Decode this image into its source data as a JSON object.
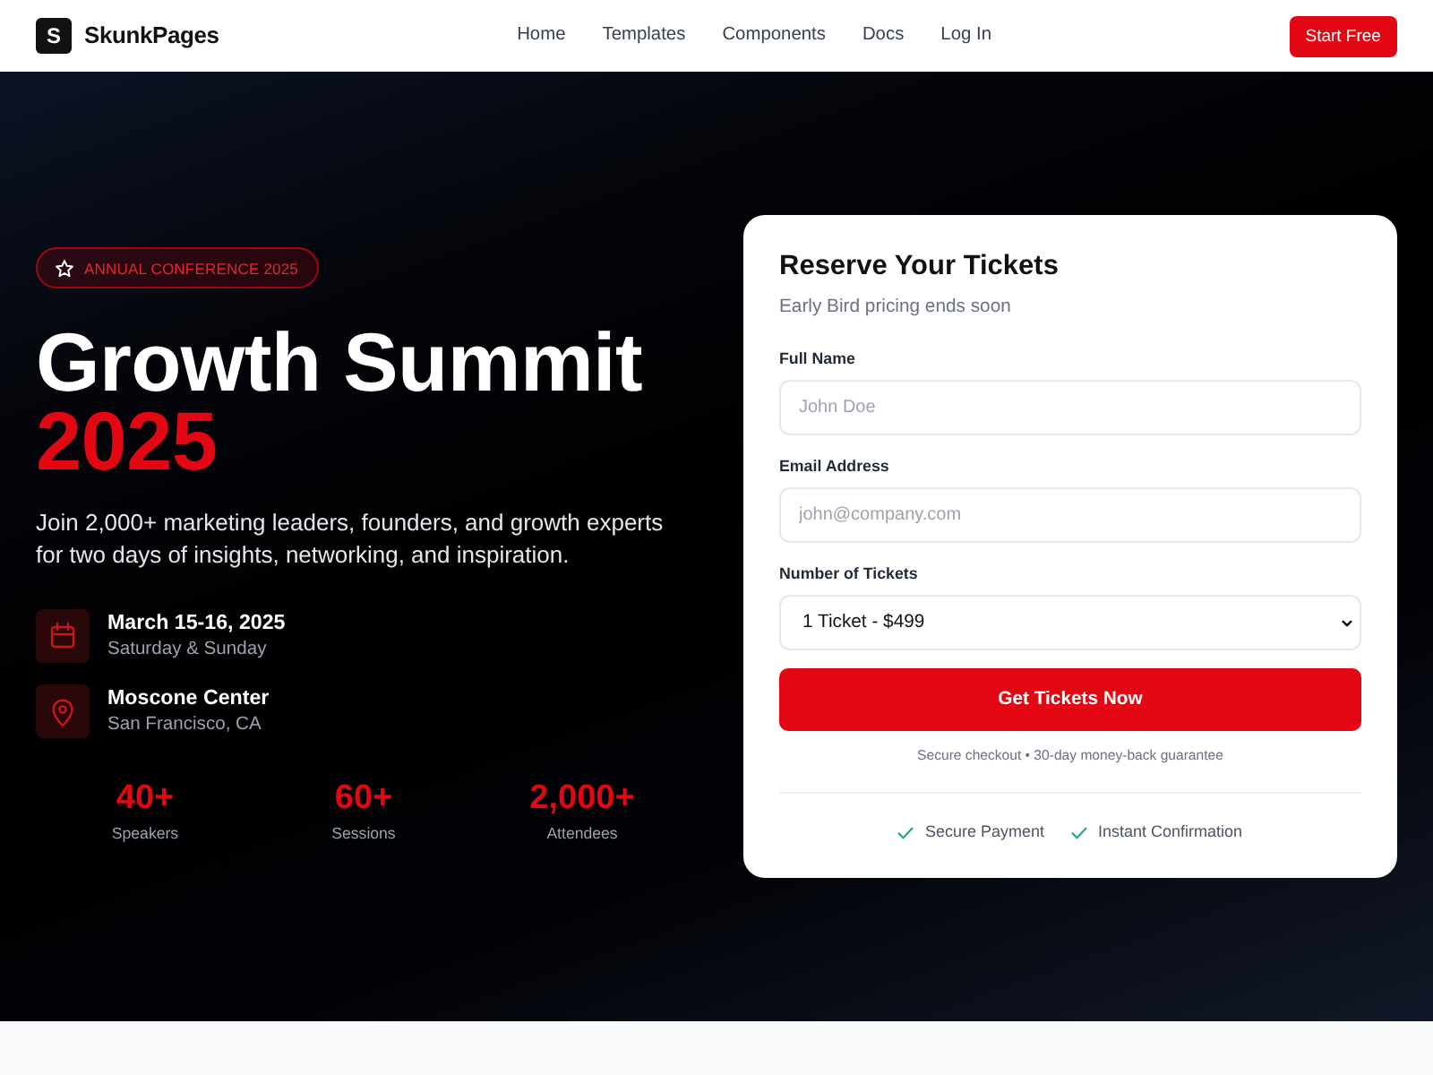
{
  "navbar": {
    "logo_letter": "S",
    "brand": "SkunkPages",
    "links": [
      {
        "label": "Home"
      },
      {
        "label": "Templates"
      },
      {
        "label": "Components"
      },
      {
        "label": "Docs"
      },
      {
        "label": "Log In"
      }
    ],
    "cta": "Start Free"
  },
  "hero": {
    "badge": "ANNUAL CONFERENCE 2025",
    "title": "Growth Summit",
    "title_accent": "2025",
    "description": "Join 2,000+ marketing leaders, founders, and growth experts for two days of insights, networking, and inspiration.",
    "details": [
      {
        "kind": "date",
        "title": "March 15-16, 2025",
        "subtitle": "Saturday & Sunday"
      },
      {
        "kind": "location",
        "title": "Moscone Center",
        "subtitle": "San Francisco, CA"
      }
    ],
    "stats": [
      {
        "value": "40+",
        "label": "Speakers"
      },
      {
        "value": "60+",
        "label": "Sessions"
      },
      {
        "value": "2,000+",
        "label": "Attendees"
      }
    ]
  },
  "ticket_form": {
    "title": "Reserve Your Tickets",
    "subtitle": "Early Bird pricing ends soon",
    "fields": [
      {
        "kind": "text",
        "label": "Full Name",
        "placeholder": "John Doe"
      },
      {
        "kind": "text",
        "label": "Email Address",
        "placeholder": "john@company.com"
      },
      {
        "kind": "select",
        "label": "Number of Tickets",
        "value": "1 Ticket - $499"
      }
    ],
    "submit": "Get Tickets Now",
    "note": "Secure checkout • 30-day money-back guarantee",
    "assurances": [
      "Secure Payment",
      "Instant Confirmation"
    ]
  }
}
